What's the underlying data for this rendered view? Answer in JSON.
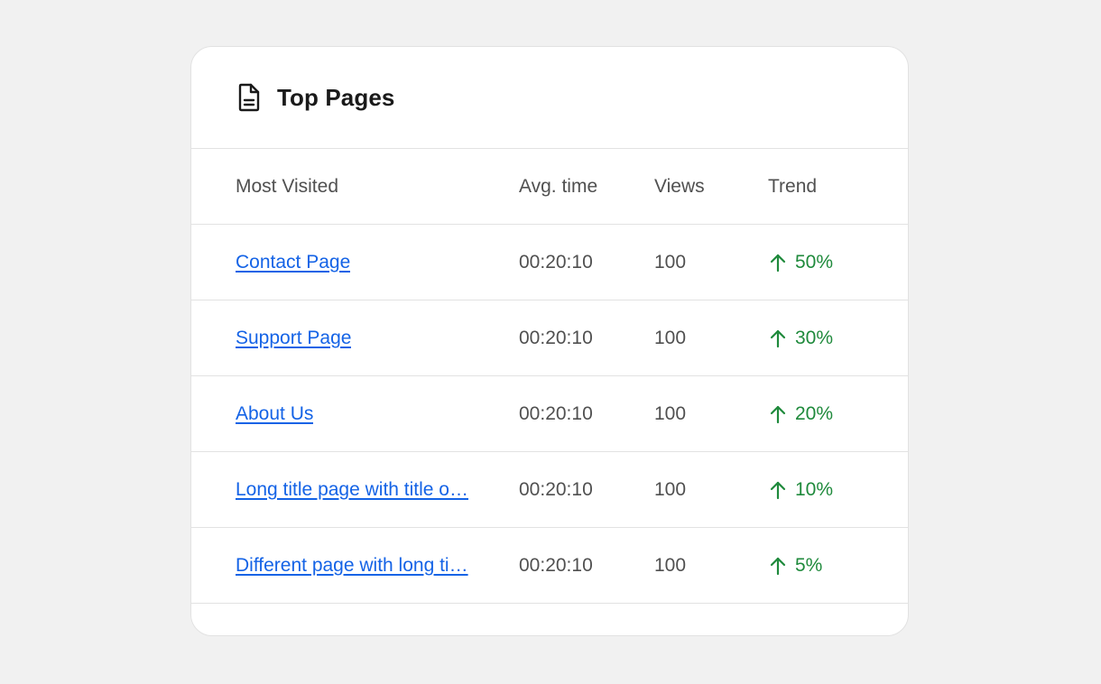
{
  "card": {
    "title": "Top Pages",
    "icon": "document-icon"
  },
  "table": {
    "columns": [
      "Most Visited",
      "Avg. time",
      "Views",
      "Trend"
    ],
    "rows": [
      {
        "page": "Contact Page",
        "avg_time": "00:20:10",
        "views": "100",
        "trend": "50%",
        "trend_icon": "arrow-up-icon"
      },
      {
        "page": "Support Page",
        "avg_time": "00:20:10",
        "views": "100",
        "trend": "30%",
        "trend_icon": "arrow-up-icon"
      },
      {
        "page": "About Us",
        "avg_time": "00:20:10",
        "views": "100",
        "trend": "20%",
        "trend_icon": "arrow-up-icon"
      },
      {
        "page": "Long title page with title o…",
        "avg_time": "00:20:10",
        "views": "100",
        "trend": "10%",
        "trend_icon": "arrow-up-icon"
      },
      {
        "page": "Different page with long ti…",
        "avg_time": "00:20:10",
        "views": "100",
        "trend": "5%",
        "trend_icon": "arrow-up-icon"
      }
    ]
  },
  "colors": {
    "link": "#1463e6",
    "trend_up": "#1f8a3c",
    "background": "#f1f1f1",
    "card": "#ffffff"
  }
}
